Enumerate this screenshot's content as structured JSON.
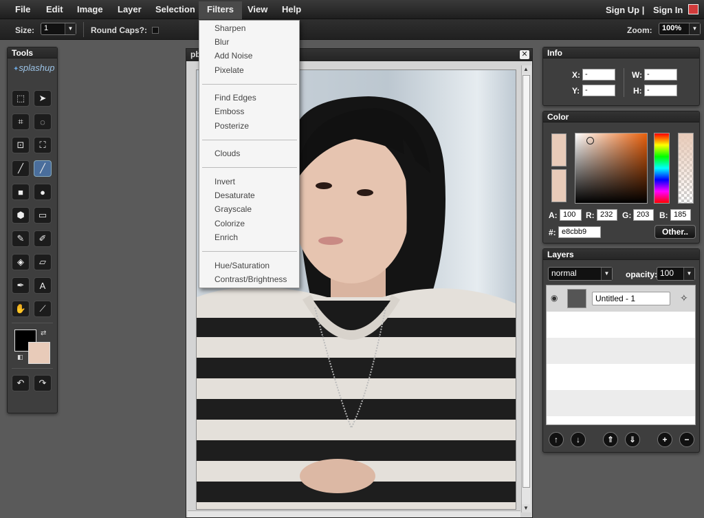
{
  "menubar": {
    "items": [
      "File",
      "Edit",
      "Image",
      "Layer",
      "Selection",
      "Filters",
      "View",
      "Help"
    ],
    "sign_up": "Sign Up |",
    "sign_in": "Sign In"
  },
  "options": {
    "size_label": "Size:",
    "size_value": "1",
    "round_caps_label": "Round Caps?:",
    "zoom_label": "Zoom:",
    "zoom_value": "100%"
  },
  "tools": {
    "title": "Tools",
    "logo": "splashup"
  },
  "document": {
    "title": "pb"
  },
  "filters_menu": {
    "group1": [
      "Sharpen",
      "Blur",
      "Add Noise",
      "Pixelate"
    ],
    "group2": [
      "Find Edges",
      "Emboss",
      "Posterize"
    ],
    "group3": [
      "Clouds"
    ],
    "group4": [
      "Invert",
      "Desaturate",
      "Grayscale",
      "Colorize",
      "Enrich"
    ],
    "group5": [
      "Hue/Saturation",
      "Contrast/Brightness"
    ]
  },
  "info": {
    "title": "Info",
    "x_label": "X:",
    "x_value": "-",
    "y_label": "Y:",
    "y_value": "-",
    "w_label": "W:",
    "w_value": "-",
    "h_label": "H:",
    "h_value": "-"
  },
  "color": {
    "title": "Color",
    "a_label": "A:",
    "a_value": "100",
    "r_label": "R:",
    "r_value": "232",
    "g_label": "G:",
    "g_value": "203",
    "b_label": "B:",
    "b_value": "185",
    "hex_label": "#:",
    "hex_value": "e8cbb9",
    "other_button": "Other..",
    "current_color": "#e8cbb9",
    "foreground_color": "#000000"
  },
  "layers": {
    "title": "Layers",
    "blend_mode": "normal",
    "opacity_label": "opacity:",
    "opacity_value": "100",
    "layer_name": "Untitled - 1"
  }
}
